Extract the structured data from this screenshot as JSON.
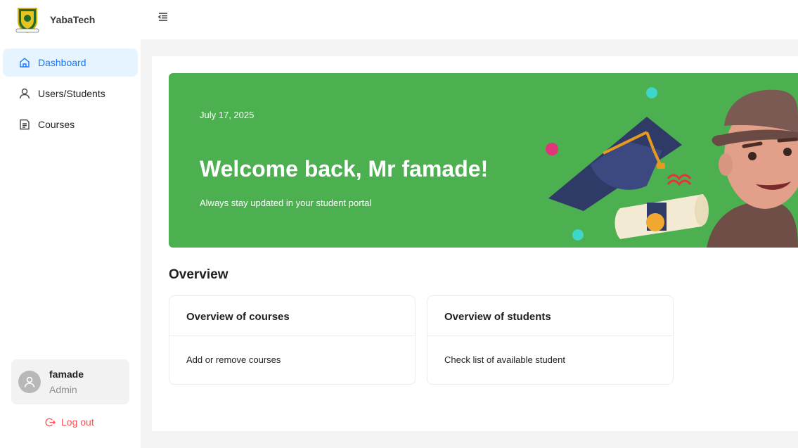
{
  "brand": {
    "name": "YabaTech"
  },
  "sidebar": {
    "items": [
      {
        "label": "Dashboard",
        "icon": "home-icon",
        "active": true
      },
      {
        "label": "Users/Students",
        "icon": "user-icon",
        "active": false
      },
      {
        "label": "Courses",
        "icon": "document-icon",
        "active": false
      }
    ]
  },
  "user": {
    "name": "famade",
    "role": "Admin"
  },
  "logout": {
    "label": "Log out"
  },
  "banner": {
    "date": "July 17, 2025",
    "title": "Welcome back, Mr famade!",
    "subtitle": "Always stay updated in your student portal"
  },
  "overview": {
    "heading": "Overview",
    "cards": [
      {
        "title": "Overview of courses",
        "body": "Add or remove courses"
      },
      {
        "title": "Overview of students",
        "body": "Check list of available student"
      }
    ]
  },
  "colors": {
    "accent": "#1677ff",
    "active_bg": "#e6f4ff",
    "banner_green": "#4caf50",
    "logout_red": "#ff4d4f"
  }
}
